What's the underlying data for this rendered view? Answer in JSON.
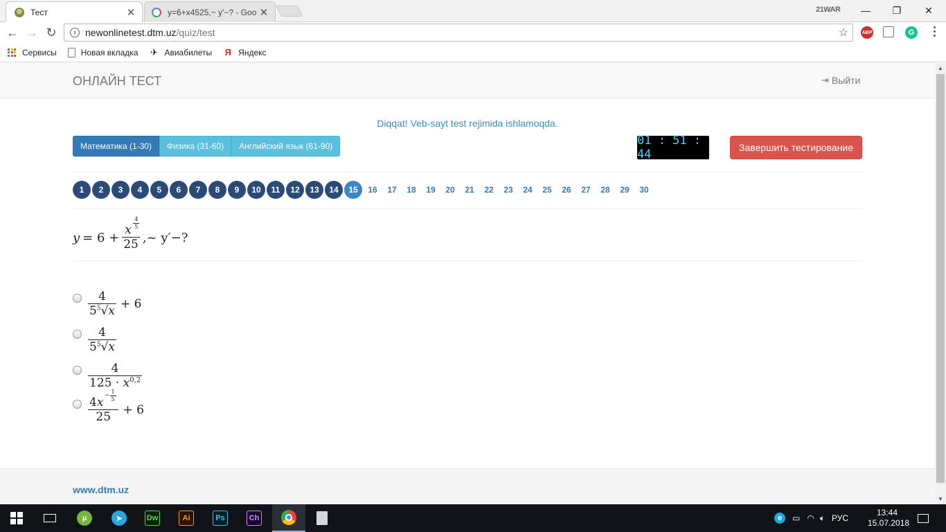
{
  "browser": {
    "tabs": [
      {
        "title": "Тест",
        "active": true
      },
      {
        "title": "y=6+x4525,~ y'−? - Goo",
        "active": false
      }
    ],
    "profile_label": "21WAR",
    "url_host": "newonlinetest.dtm.uz",
    "url_path": "/quiz/test",
    "extensions": {
      "abp": "ABP",
      "grammarly": "G"
    },
    "bookmarks": [
      "Сервисы",
      "Новая вкладка",
      "Авиабилеты",
      "Яндекс"
    ]
  },
  "site": {
    "brand": "ОНЛАЙН ТЕСТ",
    "logout_label": "Выйти",
    "notice": "Diqqat! Veb-sayt test rejimida ishlamoqda.",
    "subjects": [
      "Математика (1-30)",
      "Физика (31-60)",
      "Английский язык (61-90)"
    ],
    "timer": "01 : 51 : 44",
    "finish_label": "Завершить тестирование",
    "questions": {
      "done": [
        "1",
        "2",
        "3",
        "4",
        "5",
        "6",
        "7",
        "8",
        "9",
        "10",
        "11",
        "12",
        "13",
        "14"
      ],
      "current": "15",
      "todo": [
        "16",
        "17",
        "18",
        "19",
        "20",
        "21",
        "22",
        "23",
        "24",
        "25",
        "26",
        "27",
        "28",
        "29",
        "30"
      ]
    },
    "question_math": {
      "y": "y",
      "eq": "= 6 +",
      "x": "x",
      "exp_num": "4",
      "exp_den": "5",
      "den": "25",
      "tail": ",~ y′−?"
    },
    "options": [
      {
        "num": "4",
        "den_coef": "5",
        "root_index": "5",
        "var": "x",
        "tail": "+ 6"
      },
      {
        "num": "4",
        "den_coef": "5",
        "root_index": "5",
        "var": "x",
        "tail": ""
      },
      {
        "num": "4",
        "den": "125 · ",
        "var": "x",
        "exp": "0,2"
      },
      {
        "num_coef": "4",
        "var": "x",
        "exp_sign": "−",
        "exp_num": "1",
        "exp_den": "5",
        "den": "25",
        "tail": "+ 6"
      }
    ],
    "footer_link": "www.dtm.uz"
  },
  "taskbar": {
    "apps": [
      "Dw",
      "Ai",
      "Ps",
      "Ch"
    ],
    "lang": "РУС",
    "time": "13:44",
    "date": "15.07.2018"
  }
}
